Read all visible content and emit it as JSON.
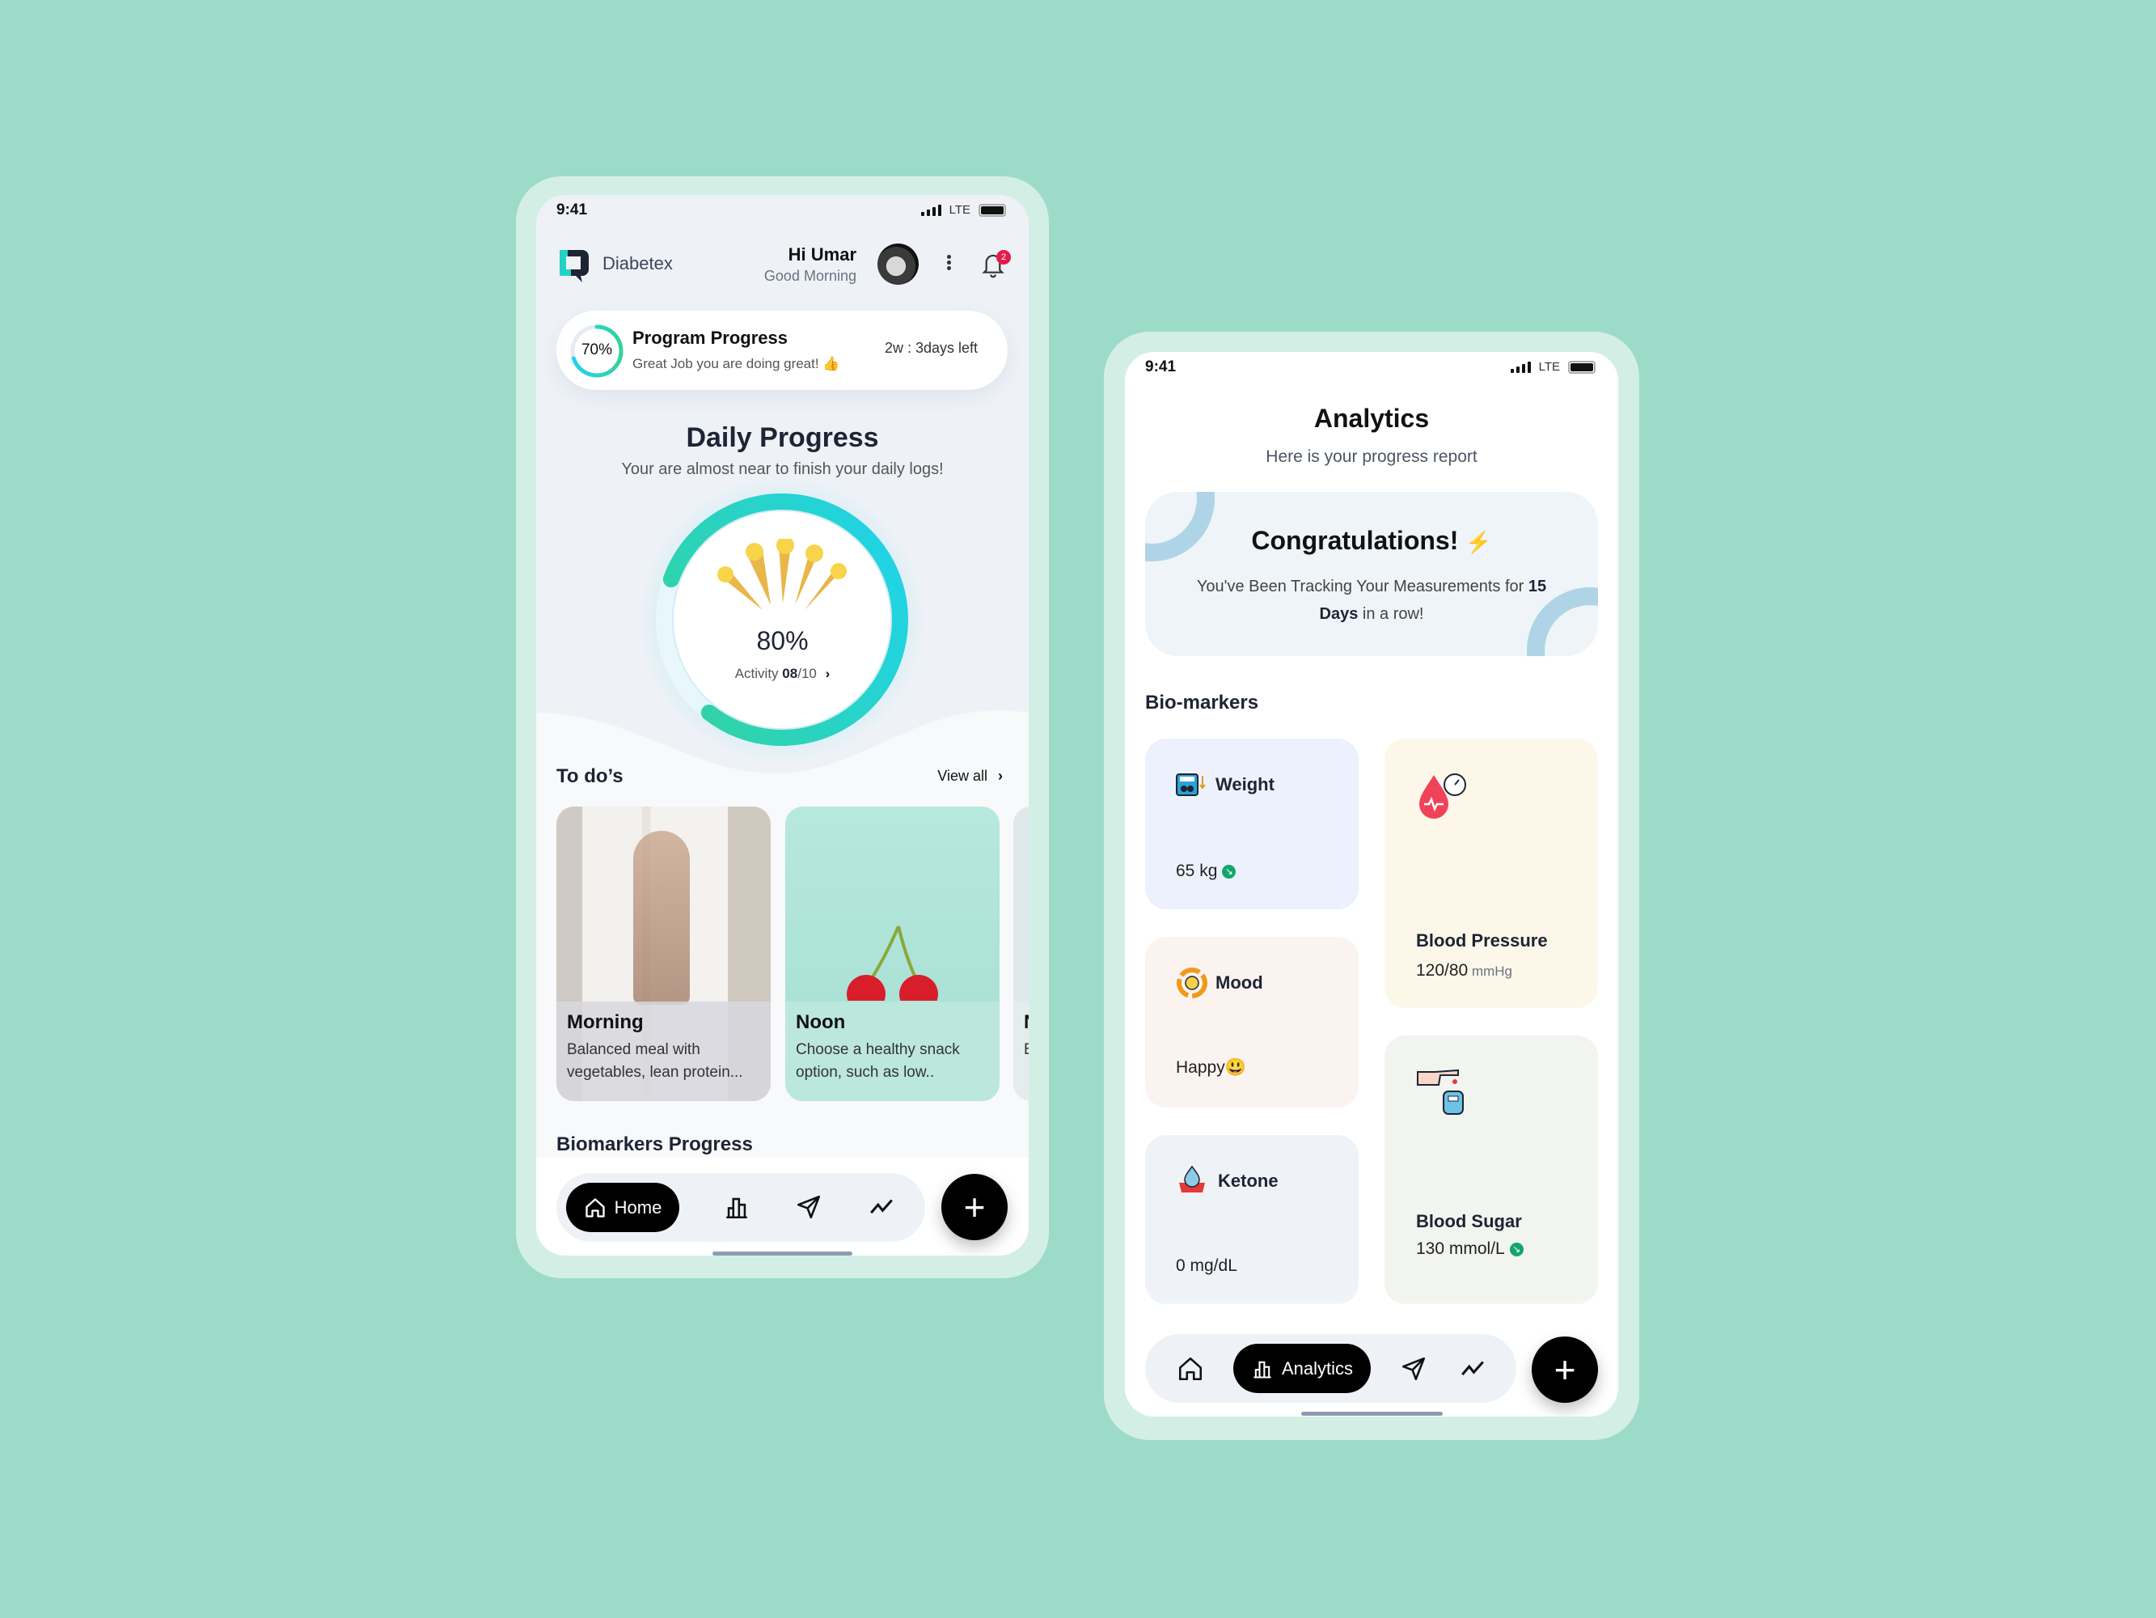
{
  "home": {
    "status": {
      "time": "9:41",
      "network": "LTE"
    },
    "app_name": "Diabetex",
    "greeting": "Hi Umar",
    "greeting_sub": "Good Morning",
    "notification_count": "2",
    "program": {
      "percent_label": "70%",
      "percent": 70,
      "title": "Program Progress",
      "subtitle": "Great Job you are doing great! 👍",
      "time_left": "2w : 3days left"
    },
    "daily": {
      "title": "Daily Progress",
      "subtitle": "Your are almost near to finish your daily logs!",
      "percent_label": "80%",
      "percent": 80,
      "activity_label": "Activity",
      "activity_done": "08",
      "activity_total": "/10"
    },
    "todos": {
      "title": "To do’s",
      "view_all": "View all",
      "items": [
        {
          "title": "Morning",
          "desc": "Balanced meal with vegetables, lean protein..."
        },
        {
          "title": "Noon",
          "desc": "Choose a healthy snack option, such as low.."
        },
        {
          "title": "N",
          "desc": "B v"
        }
      ]
    },
    "biomarkers_title": "Biomarkers Progress",
    "nav": {
      "home": "Home"
    }
  },
  "analytics": {
    "status": {
      "time": "9:41",
      "network": "LTE"
    },
    "title": "Analytics",
    "subtitle": "Here is your progress report",
    "congrats": {
      "title": "Congratulations!",
      "icon": "⚡",
      "text": "You've Been Tracking Your Measurements for ",
      "days": "15 Days",
      "text_end": " in a row!"
    },
    "biomarkers_title": "Bio-markers",
    "cards": {
      "weight": {
        "label": "Weight",
        "value": "65 kg"
      },
      "mood": {
        "label": "Mood",
        "value": "Happy😃"
      },
      "ketone": {
        "label": "Ketone",
        "value": "0 mg/dL"
      },
      "bp": {
        "label": "Blood Pressure",
        "value": "120/80",
        "unit": " mmHg"
      },
      "sugar": {
        "label": "Blood Sugar",
        "value": "130 mmol/L"
      }
    },
    "nav": {
      "analytics": "Analytics"
    }
  },
  "colors": {
    "background": "#9cdbc8",
    "accent_green": "#34d399",
    "accent_cyan": "#22d3ee",
    "badge": "#e11d48"
  }
}
